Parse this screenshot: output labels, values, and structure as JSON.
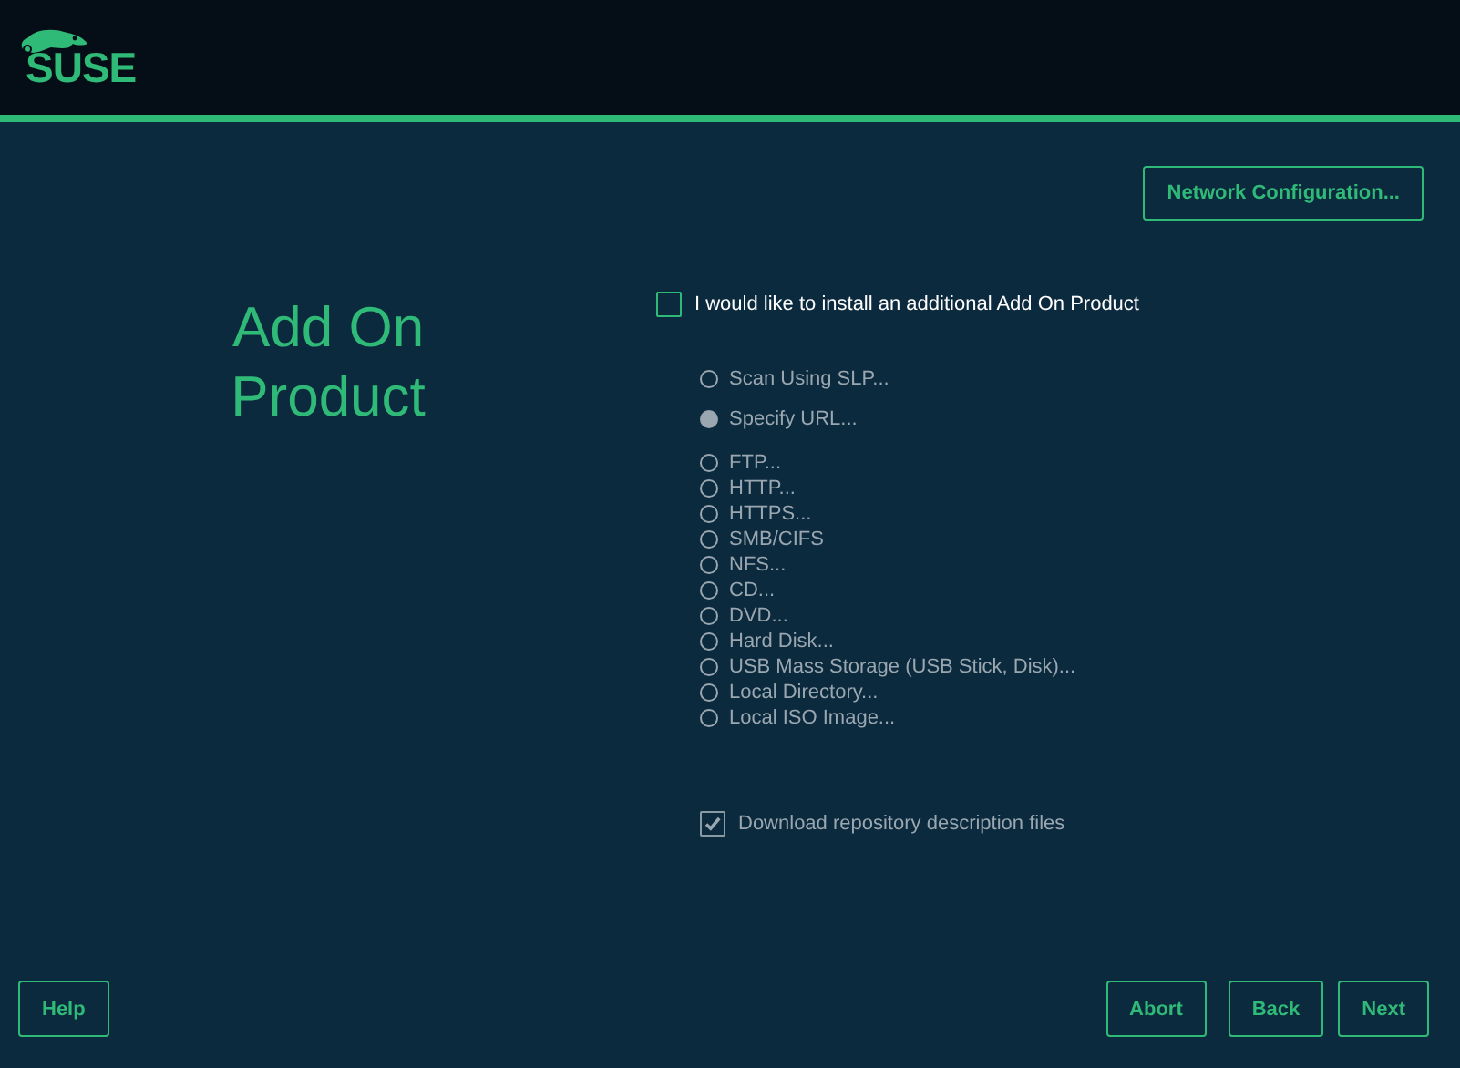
{
  "header": {
    "logo": "SUSE"
  },
  "toolbar": {
    "network_button": "Network Configuration..."
  },
  "title": "Add On Product",
  "addon_checkbox": {
    "label": "I would like to install an additional Add On Product",
    "checked": false
  },
  "source_modes": [
    {
      "label": "Scan Using SLP...",
      "selected": false,
      "disabled": true
    },
    {
      "label": "Specify URL...",
      "selected": true,
      "disabled": true
    }
  ],
  "sources": [
    {
      "label": "FTP...",
      "selected": false,
      "disabled": true
    },
    {
      "label": "HTTP...",
      "selected": false,
      "disabled": true
    },
    {
      "label": "HTTPS...",
      "selected": false,
      "disabled": true
    },
    {
      "label": "SMB/CIFS",
      "selected": false,
      "disabled": true
    },
    {
      "label": "NFS...",
      "selected": false,
      "disabled": true
    },
    {
      "label": "CD...",
      "selected": false,
      "disabled": true
    },
    {
      "label": "DVD...",
      "selected": false,
      "disabled": true
    },
    {
      "label": "Hard Disk...",
      "selected": false,
      "disabled": true
    },
    {
      "label": "USB Mass Storage (USB Stick, Disk)...",
      "selected": false,
      "disabled": true
    },
    {
      "label": "Local Directory...",
      "selected": false,
      "disabled": true
    },
    {
      "label": "Local ISO Image...",
      "selected": false,
      "disabled": true
    }
  ],
  "download_checkbox": {
    "label": "Download repository description files",
    "checked": true,
    "disabled": true
  },
  "buttons": {
    "help": "Help",
    "abort": "Abort",
    "back": "Back",
    "next": "Next"
  }
}
